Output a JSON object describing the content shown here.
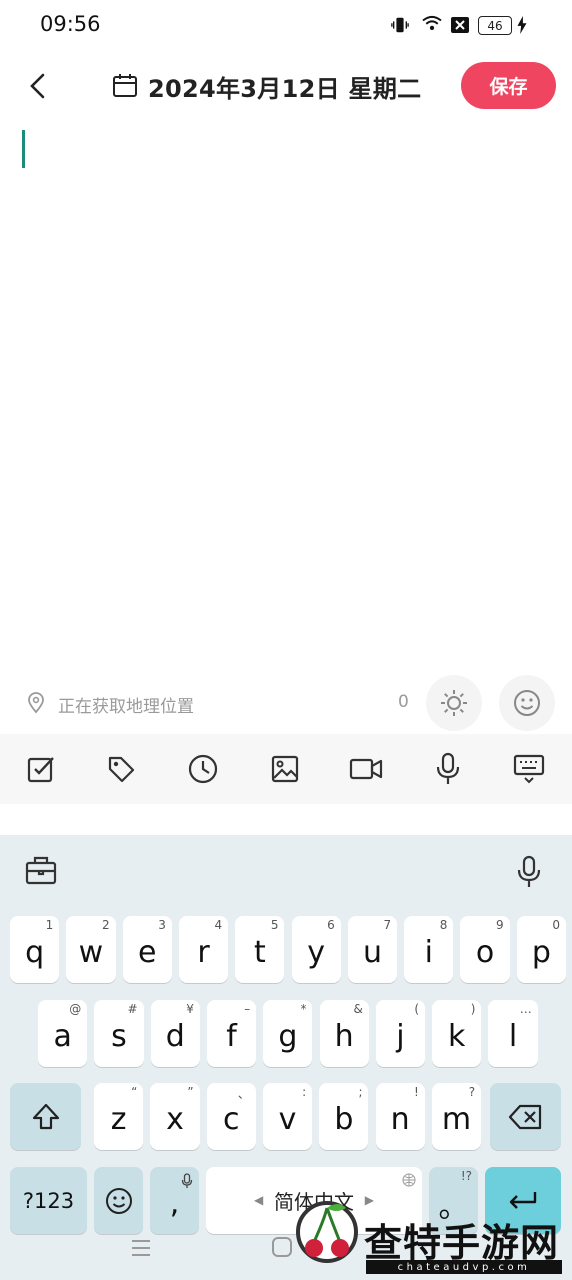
{
  "status_bar": {
    "time": "09:56",
    "battery": "46",
    "icons": [
      "vibrate-icon",
      "wifi-icon",
      "sim-blocked-icon",
      "battery-icon",
      "charging-icon"
    ]
  },
  "header": {
    "date": "2024年3月12日 星期二",
    "save_label": "保存",
    "save_color": "#ef4561"
  },
  "editor": {
    "caret_color": "#1a8c7a",
    "location_text": "正在获取地理位置",
    "char_count": "0"
  },
  "toolbar": {
    "icons": [
      "checkbox-icon",
      "tag-icon",
      "clock-icon",
      "image-icon",
      "video-icon",
      "microphone-icon",
      "keyboard-hide-icon"
    ]
  },
  "keyboard": {
    "row1": [
      {
        "k": "q",
        "s": "1"
      },
      {
        "k": "w",
        "s": "2"
      },
      {
        "k": "e",
        "s": "3"
      },
      {
        "k": "r",
        "s": "4"
      },
      {
        "k": "t",
        "s": "5"
      },
      {
        "k": "y",
        "s": "6"
      },
      {
        "k": "u",
        "s": "7"
      },
      {
        "k": "i",
        "s": "8"
      },
      {
        "k": "o",
        "s": "9"
      },
      {
        "k": "p",
        "s": "0"
      }
    ],
    "row2": [
      {
        "k": "a",
        "s": "@"
      },
      {
        "k": "s",
        "s": "#"
      },
      {
        "k": "d",
        "s": "¥"
      },
      {
        "k": "f",
        "s": "–"
      },
      {
        "k": "g",
        "s": "*"
      },
      {
        "k": "h",
        "s": "&"
      },
      {
        "k": "j",
        "s": "("
      },
      {
        "k": "k",
        "s": ")"
      },
      {
        "k": "l",
        "s": "…"
      }
    ],
    "row3": [
      {
        "k": "z",
        "s": "“"
      },
      {
        "k": "x",
        "s": "”"
      },
      {
        "k": "c",
        "s": "、"
      },
      {
        "k": "v",
        "s": ":"
      },
      {
        "k": "b",
        "s": ";"
      },
      {
        "k": "n",
        "s": "!"
      },
      {
        "k": "m",
        "s": "?"
      }
    ],
    "symbols_label": "?123",
    "comma_label": ",",
    "space_label": "简体中文",
    "period_label": "。",
    "period_sup": "!?",
    "accent_color": "#6ecfdc"
  },
  "watermark": {
    "title": "查特手游网",
    "subtitle": "chateaudvp.com"
  }
}
